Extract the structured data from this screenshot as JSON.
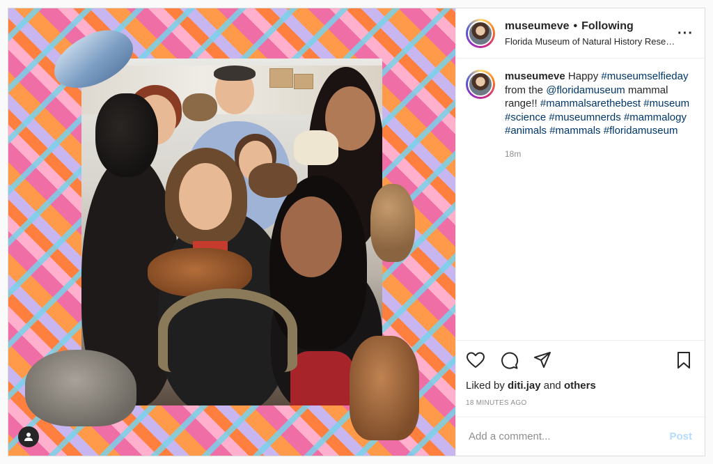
{
  "post": {
    "username": "museumeve",
    "follow_state": "Following",
    "location": "Florida Museum of Natural History Research Center",
    "more_icon": "more-horizontal-icon"
  },
  "caption": {
    "username": "museumeve",
    "parts": [
      {
        "text": "Happy ",
        "tag": false
      },
      {
        "text": "#museumselfieday",
        "tag": true
      },
      {
        "text": " from the ",
        "tag": false
      },
      {
        "text": "@floridamuseum",
        "tag": true
      },
      {
        "text": " mammal range!! ",
        "tag": false
      },
      {
        "text": "#mammalsarethebest",
        "tag": true
      },
      {
        "text": " ",
        "tag": false
      },
      {
        "text": "#museum",
        "tag": true
      },
      {
        "text": " ",
        "tag": false
      },
      {
        "text": "#science",
        "tag": true
      },
      {
        "text": " ",
        "tag": false
      },
      {
        "text": "#museumnerds",
        "tag": true
      },
      {
        "text": " ",
        "tag": false
      },
      {
        "text": "#mammalogy",
        "tag": true
      },
      {
        "text": " ",
        "tag": false
      },
      {
        "text": "#animals",
        "tag": true
      },
      {
        "text": " ",
        "tag": false
      },
      {
        "text": "#mammals",
        "tag": true
      },
      {
        "text": " ",
        "tag": false
      },
      {
        "text": "#floridamuseum",
        "tag": true
      }
    ],
    "time": "18m"
  },
  "actions": {
    "like_icon": "heart-icon",
    "comment_icon": "comment-icon",
    "share_icon": "paper-plane-icon",
    "save_icon": "bookmark-icon"
  },
  "likes": {
    "prefix": "Liked by",
    "user": "diti.jay",
    "joiner": "and",
    "others": "others"
  },
  "timestamp": "18 MINUTES AGO",
  "comment_box": {
    "placeholder": "Add a comment...",
    "post_label": "Post"
  },
  "colors": {
    "tag": "#00376b",
    "post_disabled": "#b3dbff",
    "muted": "#8e8e8e"
  }
}
